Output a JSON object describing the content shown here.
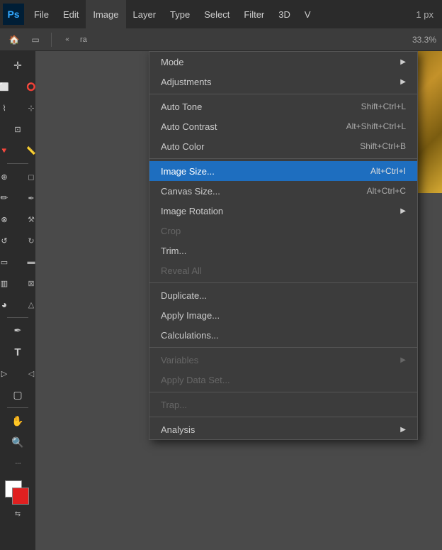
{
  "app": {
    "logo": "Ps",
    "title": "Adobe Photoshop"
  },
  "menuBar": {
    "items": [
      {
        "id": "file",
        "label": "File"
      },
      {
        "id": "edit",
        "label": "Edit"
      },
      {
        "id": "image",
        "label": "Image",
        "active": true
      },
      {
        "id": "layer",
        "label": "Layer"
      },
      {
        "id": "type",
        "label": "Type"
      },
      {
        "id": "select",
        "label": "Select"
      },
      {
        "id": "filter",
        "label": "Filter"
      },
      {
        "id": "3d",
        "label": "3D"
      },
      {
        "id": "view",
        "label": "V"
      }
    ],
    "rightInfo": "1 px"
  },
  "secondaryToolbar": {
    "label": "ra",
    "inputValue": "",
    "rightInfo": "33.3%"
  },
  "imageMenu": {
    "items": [
      {
        "id": "mode",
        "label": "Mode",
        "hasArrow": true,
        "shortcut": ""
      },
      {
        "id": "adjustments",
        "label": "Adjustments",
        "hasArrow": true,
        "shortcut": ""
      },
      {
        "id": "divider1",
        "divider": true
      },
      {
        "id": "auto-tone",
        "label": "Auto Tone",
        "shortcut": "Shift+Ctrl+L"
      },
      {
        "id": "auto-contrast",
        "label": "Auto Contrast",
        "shortcut": "Alt+Shift+Ctrl+L"
      },
      {
        "id": "auto-color",
        "label": "Auto Color",
        "shortcut": "Shift+Ctrl+B"
      },
      {
        "id": "divider2",
        "divider": true
      },
      {
        "id": "image-size",
        "label": "Image Size...",
        "shortcut": "Alt+Ctrl+I",
        "highlighted": true
      },
      {
        "id": "canvas-size",
        "label": "Canvas Size...",
        "shortcut": "Alt+Ctrl+C"
      },
      {
        "id": "image-rotation",
        "label": "Image Rotation",
        "hasArrow": true,
        "shortcut": ""
      },
      {
        "id": "crop",
        "label": "Crop",
        "disabled": true,
        "shortcut": ""
      },
      {
        "id": "trim",
        "label": "Trim...",
        "shortcut": ""
      },
      {
        "id": "reveal-all",
        "label": "Reveal All",
        "disabled": true,
        "shortcut": ""
      },
      {
        "id": "divider3",
        "divider": true
      },
      {
        "id": "duplicate",
        "label": "Duplicate...",
        "shortcut": ""
      },
      {
        "id": "apply-image",
        "label": "Apply Image...",
        "shortcut": ""
      },
      {
        "id": "calculations",
        "label": "Calculations...",
        "shortcut": ""
      },
      {
        "id": "divider4",
        "divider": true
      },
      {
        "id": "variables",
        "label": "Variables",
        "disabled": true,
        "hasArrow": true,
        "shortcut": ""
      },
      {
        "id": "apply-data-set",
        "label": "Apply Data Set...",
        "disabled": true,
        "shortcut": ""
      },
      {
        "id": "divider5",
        "divider": true
      },
      {
        "id": "trap",
        "label": "Trap...",
        "disabled": true,
        "shortcut": ""
      },
      {
        "id": "divider6",
        "divider": true
      },
      {
        "id": "analysis",
        "label": "Analysis",
        "hasArrow": true,
        "shortcut": ""
      }
    ]
  },
  "tools": [
    {
      "id": "move",
      "icon": "✛",
      "name": "move-tool"
    },
    {
      "id": "marquee-elliptical",
      "icon": "◯",
      "name": "marquee-tool"
    },
    {
      "id": "lasso",
      "icon": "⌇",
      "name": "lasso-tool"
    },
    {
      "id": "magic-wand",
      "icon": "⋮",
      "name": "magic-wand-tool"
    },
    {
      "id": "crop",
      "icon": "⊡",
      "name": "crop-tool"
    },
    {
      "id": "eyedropper",
      "icon": "🔻",
      "name": "eyedropper-tool"
    },
    {
      "id": "healing",
      "icon": "⊕",
      "name": "healing-tool"
    },
    {
      "id": "brush",
      "icon": "✏",
      "name": "brush-tool"
    },
    {
      "id": "clone",
      "icon": "⊗",
      "name": "clone-tool"
    },
    {
      "id": "history",
      "icon": "↺",
      "name": "history-tool"
    },
    {
      "id": "eraser",
      "icon": "▭",
      "name": "eraser-tool"
    },
    {
      "id": "gradient",
      "icon": "▥",
      "name": "gradient-tool"
    },
    {
      "id": "dodge",
      "icon": "◕",
      "name": "dodge-tool"
    },
    {
      "id": "pen",
      "icon": "✒",
      "name": "pen-tool"
    },
    {
      "id": "text",
      "icon": "T",
      "name": "text-tool"
    },
    {
      "id": "path-selection",
      "icon": "▷",
      "name": "path-selection-tool"
    },
    {
      "id": "shape",
      "icon": "▢",
      "name": "shape-tool"
    },
    {
      "id": "hand",
      "icon": "✋",
      "name": "hand-tool"
    },
    {
      "id": "zoom",
      "icon": "🔍",
      "name": "zoom-tool"
    },
    {
      "id": "more",
      "icon": "···",
      "name": "more-tools"
    }
  ],
  "colors": {
    "foreground": "#e02020",
    "background": "#ffffff",
    "highlightBlue": "#1e6ebf"
  }
}
